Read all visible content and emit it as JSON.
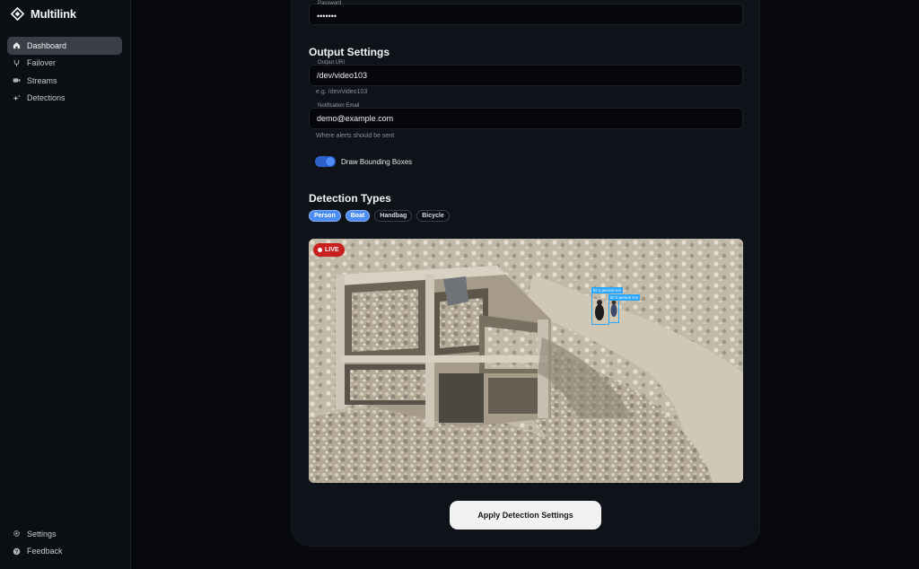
{
  "app": {
    "name": "Multilink",
    "logo_icon": "diamond-logo-icon"
  },
  "sidebar": {
    "items": [
      {
        "label": "Dashboard",
        "icon": "home-icon",
        "active": true
      },
      {
        "label": "Failover",
        "icon": "branch-icon",
        "active": false
      },
      {
        "label": "Streams",
        "icon": "video-camera-icon",
        "active": false
      },
      {
        "label": "Detections",
        "icon": "sparkles-icon",
        "active": false
      }
    ],
    "bottom": [
      {
        "label": "Settings",
        "icon": "gear-icon"
      },
      {
        "label": "Feedback",
        "icon": "help-circle-icon"
      }
    ]
  },
  "form": {
    "password": {
      "label": "Password",
      "value": "•••••••"
    },
    "output_section_title": "Output Settings",
    "output_uri": {
      "label": "Output URI",
      "value": "/dev/video103",
      "helper": "e.g. /dev/video103"
    },
    "notification_email": {
      "label": "Notification Email",
      "value": "demo@example.com",
      "helper": "Where alerts should be sent"
    },
    "draw_boxes": {
      "label": "Draw Bounding Boxes",
      "enabled": true
    }
  },
  "detection": {
    "title": "Detection Types",
    "types": [
      {
        "label": "Person",
        "selected": true
      },
      {
        "label": "Boat",
        "selected": true
      },
      {
        "label": "Handbag",
        "selected": false
      },
      {
        "label": "Bicycle",
        "selected": false
      }
    ]
  },
  "video": {
    "live_label": "LIVE",
    "boxes": [
      {
        "label": "ID:1 person 0.6"
      },
      {
        "label": "ID:2 person 0.5"
      }
    ]
  },
  "actions": {
    "apply_label": "Apply Detection Settings"
  },
  "colors": {
    "accent": "#4a8cf0",
    "live": "#c91f1f",
    "bbox": "#2aa7ff"
  }
}
